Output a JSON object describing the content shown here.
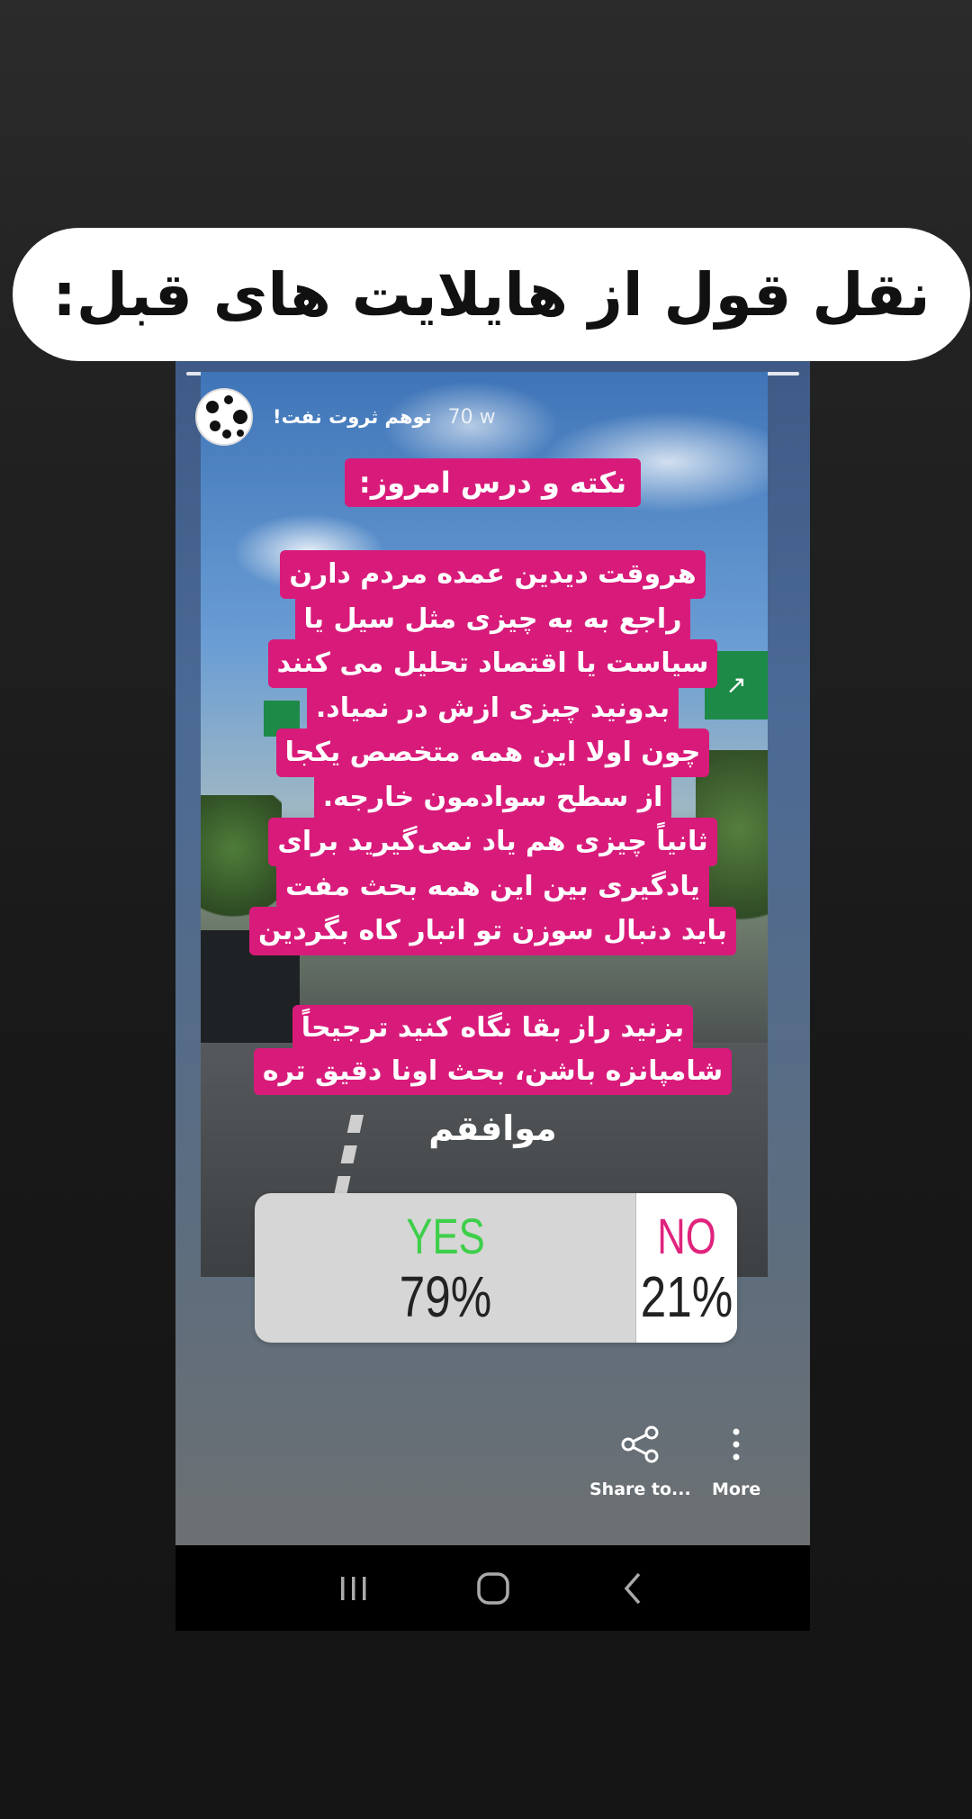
{
  "banner": {
    "text": "نقل قول از هایلایت های قبل:"
  },
  "story": {
    "username": "توهم ثروت نفت!",
    "time_ago": "70 w",
    "title": "نکته و درس امروز:",
    "body_lines": [
      "هروقت دیدین عمده مردم دارن",
      "راجع به یه چیزی مثل سیل یا",
      "سیاست یا اقتصاد تحلیل می کنند",
      "بدونید چیزی ازش در نمیاد.",
      "چون اولا این همه متخصص یکجا",
      "از سطح سوادمون خارجه.",
      "ثانیاً چیزی هم یاد نمی‌گیرید برای",
      "یادگیری بین این همه بحث مفت",
      "باید دنبال سوزن تو انبار کاه بگردین"
    ],
    "body2_lines": [
      "بزنید راز بقا نگاه کنید ترجیحاً",
      "شامپانزه باشن، بحث اونا دقیق تره"
    ],
    "agree_text": "موافقم"
  },
  "poll": {
    "yes_label": "YES",
    "yes_percent": "79%",
    "no_label": "NO",
    "no_percent": "21%",
    "yes_color": "#3ecf4a",
    "no_color": "#e0247e"
  },
  "actions": {
    "share_label": "Share to...",
    "more_label": "More"
  },
  "colors": {
    "caption_bg": "#d81b7a"
  }
}
